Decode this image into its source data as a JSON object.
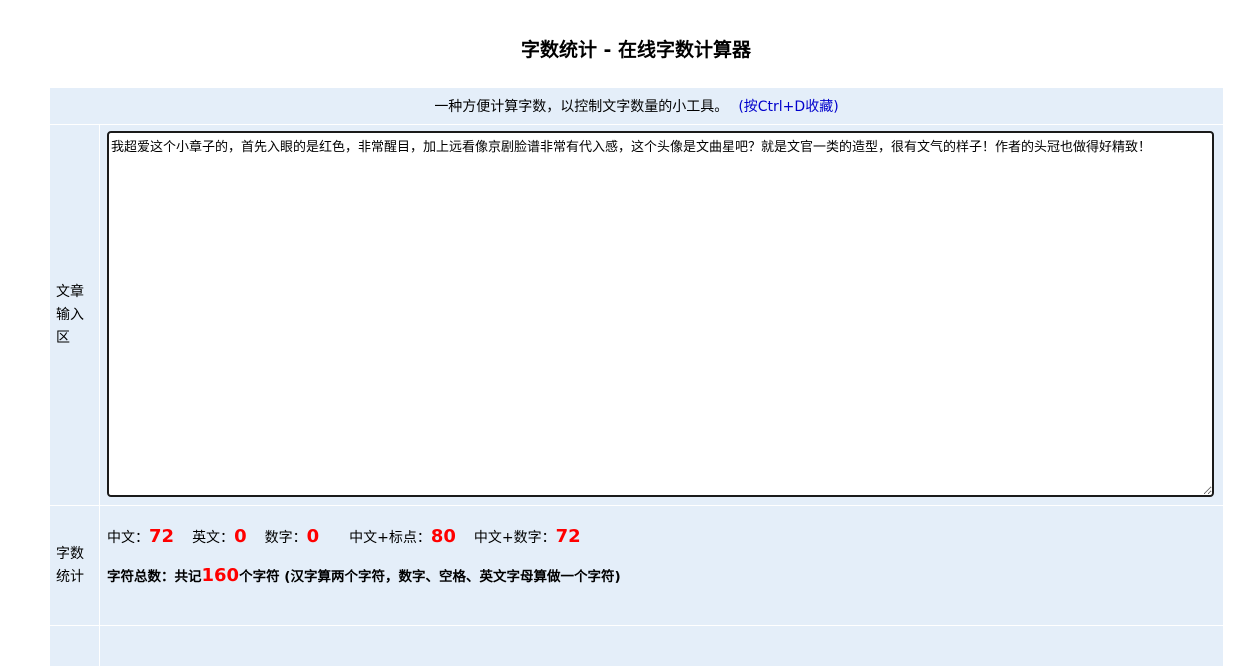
{
  "page": {
    "title": "字数统计 - 在线字数计算器"
  },
  "intro": {
    "description": "一种方便计算字数，以控制文字数量的小工具。",
    "bookmark_hint": "(按Ctrl+D收藏)"
  },
  "editor": {
    "label": "文章输入区",
    "label_lines": [
      "文章",
      "输入",
      "区"
    ],
    "content": "我超爱这个小章子的，首先入眼的是红色，非常醒目，加上远看像京剧脸谱非常有代入感，这个头像是文曲星吧？就是文官一类的造型，很有文气的样子！作者的头冠也做得好精致！"
  },
  "stats": {
    "label_lines": [
      "字数",
      "统计"
    ],
    "items": [
      {
        "label": "中文：",
        "value": "72"
      },
      {
        "label": "英文：",
        "value": "0"
      },
      {
        "label": "数字：",
        "value": "0"
      },
      {
        "label": "中文+标点：",
        "value": "80"
      },
      {
        "label": "中文+数字：",
        "value": "72"
      }
    ],
    "total_prefix": "字符总数：共记",
    "total_value": "160",
    "total_suffix": "个字符 (汉字算两个字符，数字、空格、英文字母算做一个字符)"
  },
  "colors": {
    "panel_bg": "#e4eef9",
    "value_red": "#ff0000",
    "link_blue": "#0000cc"
  }
}
